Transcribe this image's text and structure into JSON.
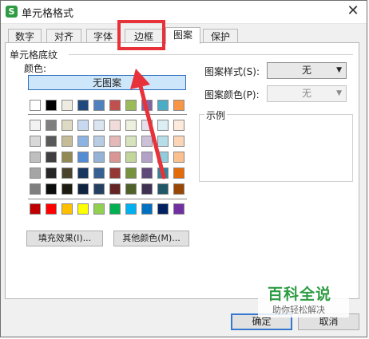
{
  "dialog": {
    "title": "单元格格式",
    "app_icon_glyph": "S",
    "close_glyph": "✕"
  },
  "tabs": [
    {
      "label": "数字"
    },
    {
      "label": "对齐"
    },
    {
      "label": "字体"
    },
    {
      "label": "边框"
    },
    {
      "label": "图案",
      "active": true
    },
    {
      "label": "保护"
    }
  ],
  "shading": {
    "group_label": "单元格底纹",
    "color_label": "颜色:",
    "no_pattern_label": "无图案",
    "palette_rows": [
      [
        "#ffffff",
        "#000000",
        "#eeece1",
        "#1f497d",
        "#4f81bd",
        "#c0504d",
        "#9bbb59",
        "#8064a2",
        "#4bacc6",
        "#f79646"
      ],
      [
        "#f2f2f2",
        "#7f7f7f",
        "#ddd9c3",
        "#c6d9f0",
        "#dbe5f1",
        "#f2dcdb",
        "#ebf1dd",
        "#e5e0ec",
        "#dbeef3",
        "#fdeada"
      ],
      [
        "#d8d8d8",
        "#595959",
        "#c4bd97",
        "#8db3e2",
        "#b8cce4",
        "#e5b9b7",
        "#d7e3bc",
        "#ccc1d9",
        "#b7dde8",
        "#fbd5b5"
      ],
      [
        "#bfbfbf",
        "#3f3f3f",
        "#938953",
        "#548dd4",
        "#95b3d7",
        "#d99694",
        "#c3d69b",
        "#b2a2c7",
        "#92cddc",
        "#fac08f"
      ],
      [
        "#a5a5a5",
        "#262626",
        "#494429",
        "#17365d",
        "#366092",
        "#953734",
        "#76923c",
        "#5f497a",
        "#31859b",
        "#e36c09"
      ],
      [
        "#7f7f7f",
        "#0c0c0c",
        "#1d1b10",
        "#0f243e",
        "#244061",
        "#632423",
        "#4f6128",
        "#3f3151",
        "#205867",
        "#974806"
      ]
    ],
    "standard_row": [
      "#c00000",
      "#ff0000",
      "#ffc000",
      "#ffff00",
      "#92d050",
      "#00b050",
      "#00b0f0",
      "#0070c0",
      "#002060",
      "#7030a0"
    ],
    "fill_effects_label": "填充效果(I)...",
    "more_colors_label": "其他颜色(M)..."
  },
  "pattern_style": {
    "label": "图案样式(S):",
    "value": "无"
  },
  "pattern_color": {
    "label": "图案颜色(P):",
    "value": "无"
  },
  "example": {
    "label": "示例"
  },
  "buttons": {
    "ok": "确定",
    "cancel": "取消"
  },
  "watermark": {
    "title": "百科全说",
    "subtitle": "助你轻松解决"
  },
  "colors": {
    "annotation": "#e8323a",
    "selected_fill": "#cde6f9",
    "watermark_green": "#2e9c43"
  }
}
